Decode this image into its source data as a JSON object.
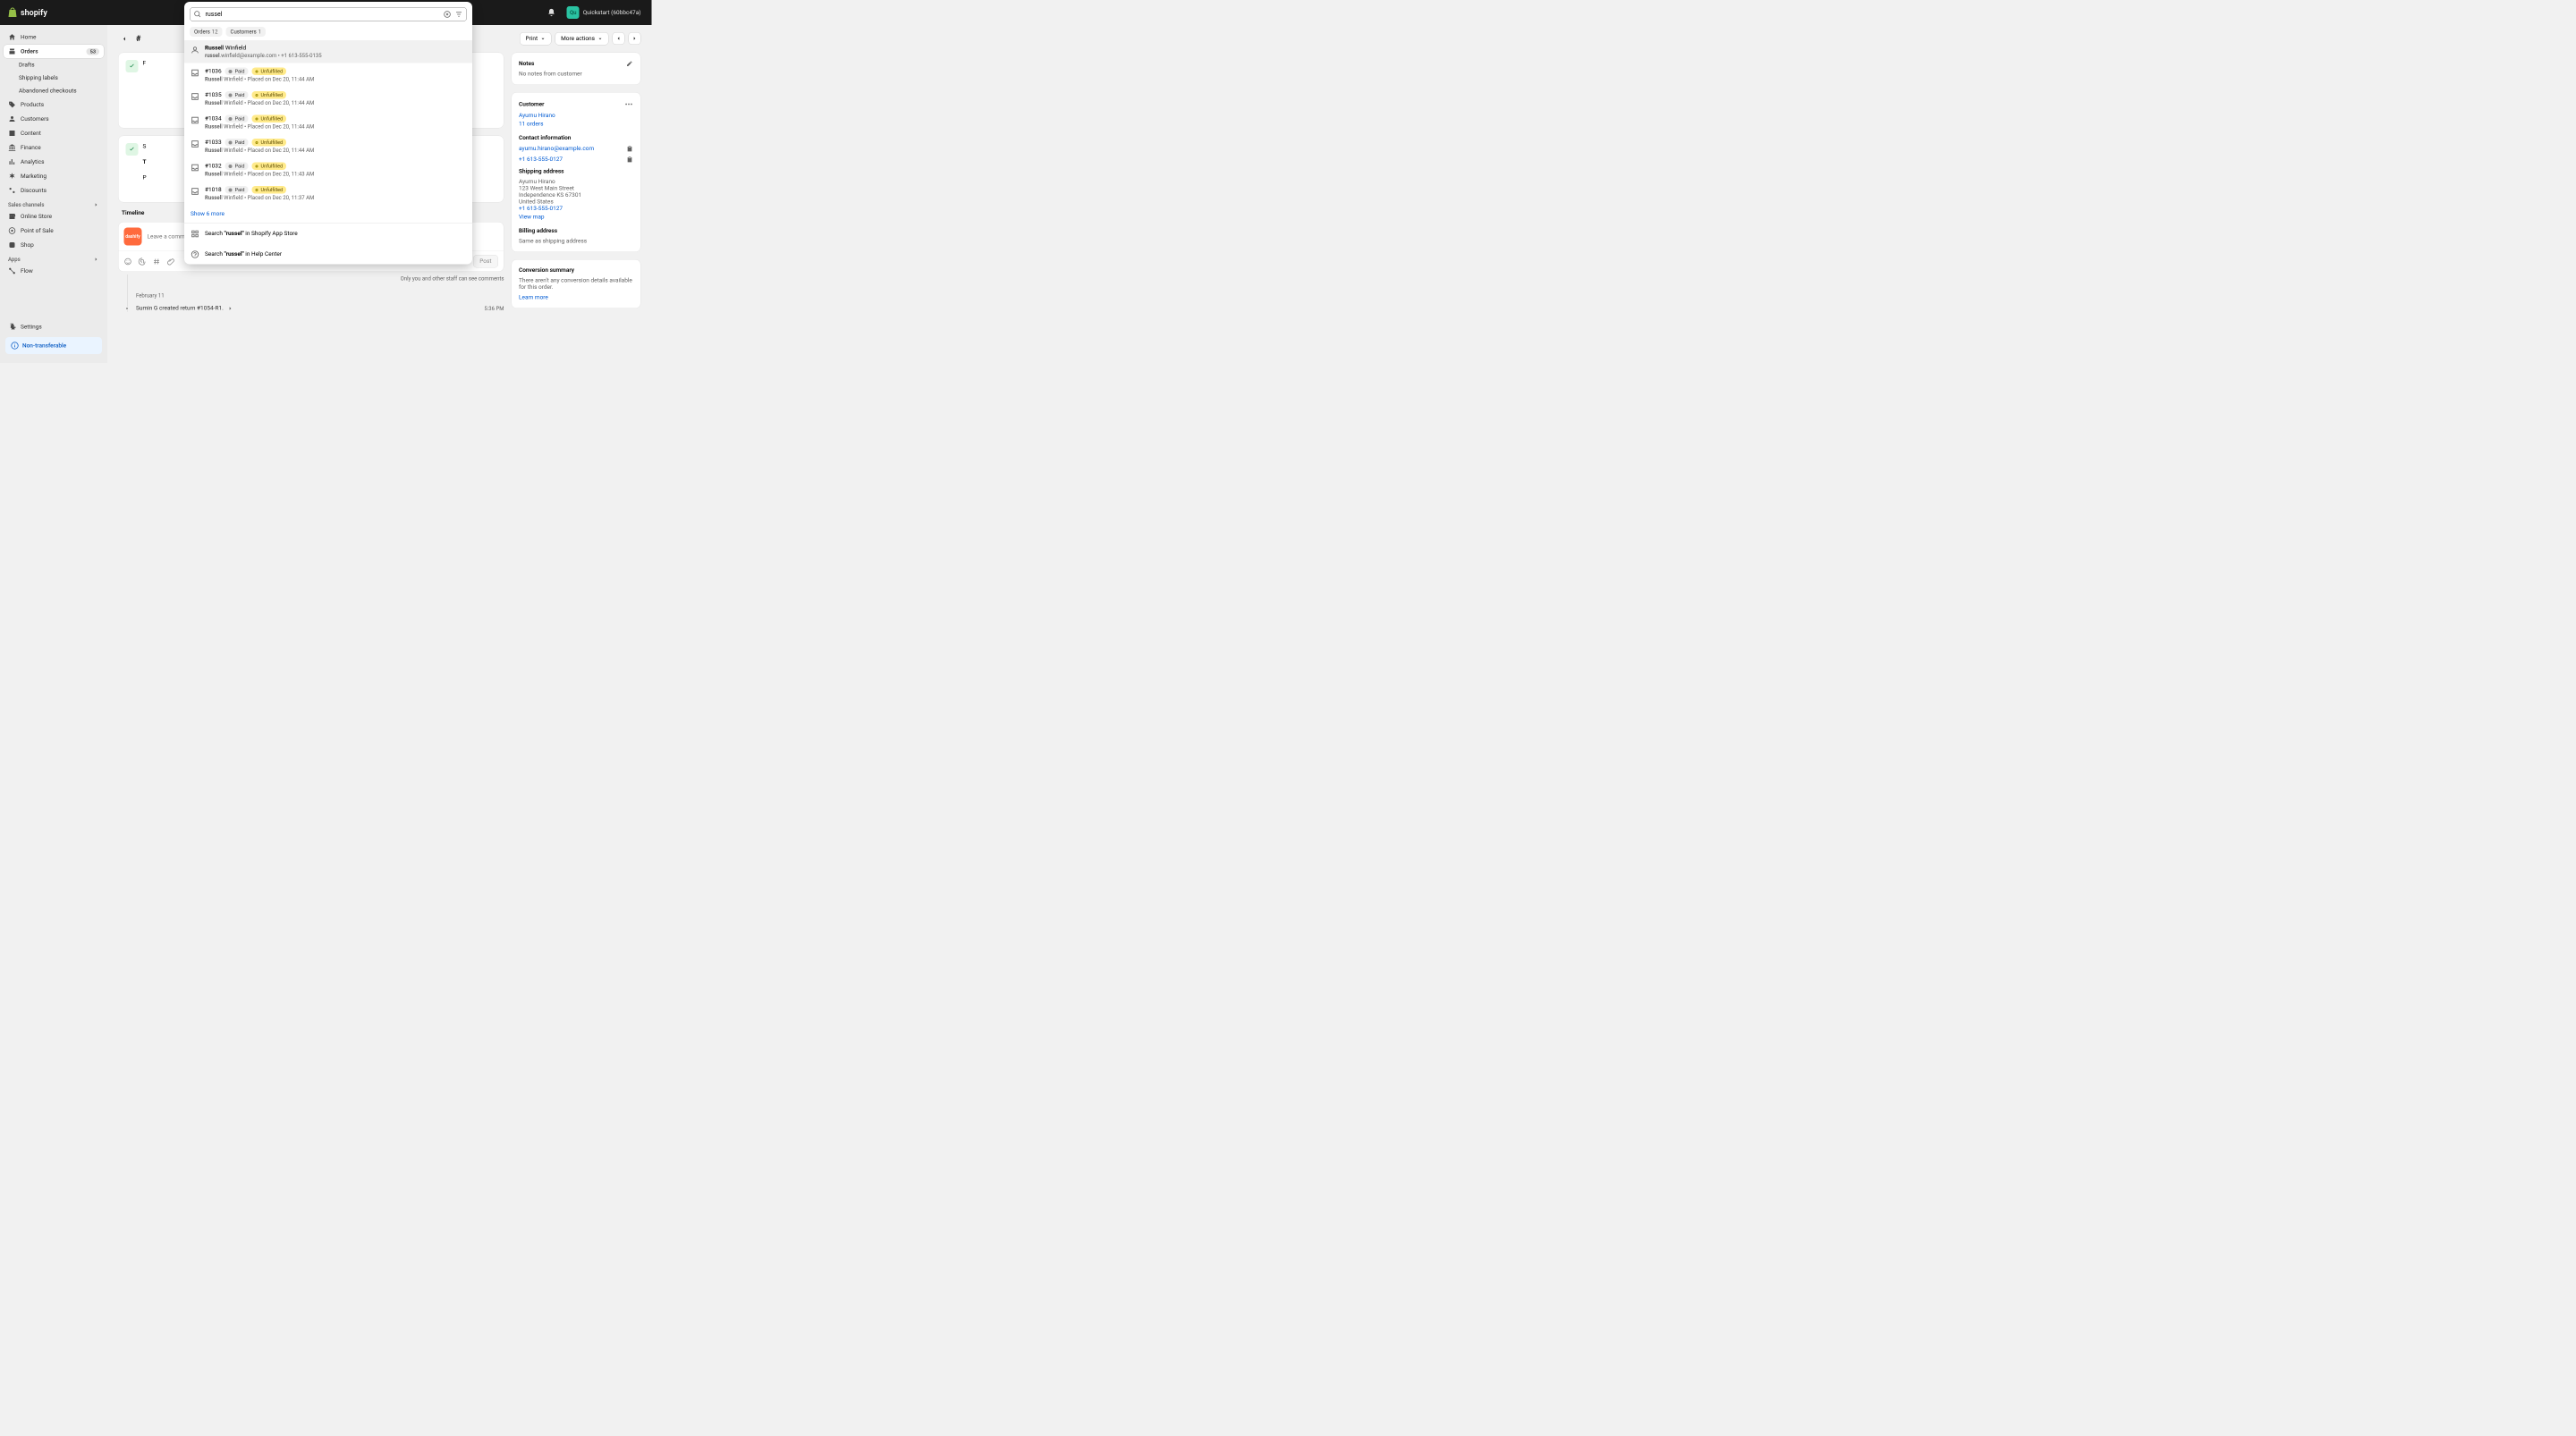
{
  "topbar": {
    "brand": "shopify",
    "store_initials": "Qu",
    "store_name": "Quickstart (60bbc47a)"
  },
  "sidebar": {
    "home": "Home",
    "orders": "Orders",
    "orders_count": "53",
    "drafts": "Drafts",
    "shipping_labels": "Shipping labels",
    "abandoned": "Abandoned checkouts",
    "products": "Products",
    "customers": "Customers",
    "content": "Content",
    "finance": "Finance",
    "analytics": "Analytics",
    "marketing": "Marketing",
    "discounts": "Discounts",
    "sales_channels": "Sales channels",
    "online_store": "Online Store",
    "point_of_sale": "Point of Sale",
    "shop": "Shop",
    "apps": "Apps",
    "flow": "Flow",
    "settings": "Settings",
    "non_transferable": "Non-transferable"
  },
  "order": {
    "print": "Print",
    "more_actions": "More actions"
  },
  "right": {
    "notes_title": "Notes",
    "notes_body": "No notes from customer",
    "customer_title": "Customer",
    "customer_name": "Ayumu Hirano",
    "customer_orders": "11 orders",
    "contact_title": "Contact information",
    "contact_email": "ayumu.hirano@example.com",
    "contact_phone": "+1 613-555-0127",
    "shipping_title": "Shipping address",
    "ship_name": "Ayumu Hirano",
    "ship_line1": "123 West Main Street",
    "ship_line2": "Independence KS 67301",
    "ship_country": "United States",
    "ship_phone": "+1 613-555-0127",
    "view_map": "View map",
    "billing_title": "Billing address",
    "billing_body": "Same as shipping address",
    "conversion_title": "Conversion summary",
    "conversion_body": "There aren't any conversion details available for this order.",
    "learn_more": "Learn more"
  },
  "timeline": {
    "title": "Timeline",
    "placeholder": "Leave a comment...",
    "post": "Post",
    "note": "Only you and other staff can see comments",
    "date": "February 11",
    "entry_text": "Sumin G created return #1054-R1.",
    "entry_time": "5:36 PM"
  },
  "search": {
    "query": "russel",
    "tabs": {
      "orders_label": "Orders",
      "orders_count": "12",
      "customers_label": "Customers",
      "customers_count": "1"
    },
    "top_result": {
      "name_prefix": "Russel",
      "name_suffix": "l Winfield",
      "email_prefix": "russel",
      "email_suffix": ".winfield@example.com",
      "sep": " • ",
      "phone": "+1 613-555-0135"
    },
    "orders": [
      {
        "id": "#1036",
        "paid": "Paid",
        "unfulfilled": "Unfulfilled",
        "cust_prefix": "Russel",
        "cust_suffix": "l Winfield",
        "meta": " • Placed on Dec 20, 11:44 AM"
      },
      {
        "id": "#1035",
        "paid": "Paid",
        "unfulfilled": "Unfulfilled",
        "cust_prefix": "Russel",
        "cust_suffix": "l Winfield",
        "meta": " • Placed on Dec 20, 11:44 AM"
      },
      {
        "id": "#1034",
        "paid": "Paid",
        "unfulfilled": "Unfulfilled",
        "cust_prefix": "Russel",
        "cust_suffix": "l Winfield",
        "meta": " • Placed on Dec 20, 11:44 AM"
      },
      {
        "id": "#1033",
        "paid": "Paid",
        "unfulfilled": "Unfulfilled",
        "cust_prefix": "Russel",
        "cust_suffix": "l Winfield",
        "meta": " • Placed on Dec 20, 11:44 AM"
      },
      {
        "id": "#1032",
        "paid": "Paid",
        "unfulfilled": "Unfulfilled",
        "cust_prefix": "Russel",
        "cust_suffix": "l Winfield",
        "meta": " • Placed on Dec 20, 11:43 AM"
      },
      {
        "id": "#1018",
        "paid": "Paid",
        "unfulfilled": "Unfulfilled",
        "cust_prefix": "Russel",
        "cust_suffix": "l Winfield",
        "meta": " • Placed on Dec 20, 11:37 AM"
      }
    ],
    "show_more": "Show 6 more",
    "app_store_pre": "Search ",
    "app_store_bold": "\"russel\"",
    "app_store_post": " in Shopify App Store",
    "help_pre": "Search ",
    "help_bold": "\"russel\"",
    "help_post": " in Help Center"
  }
}
